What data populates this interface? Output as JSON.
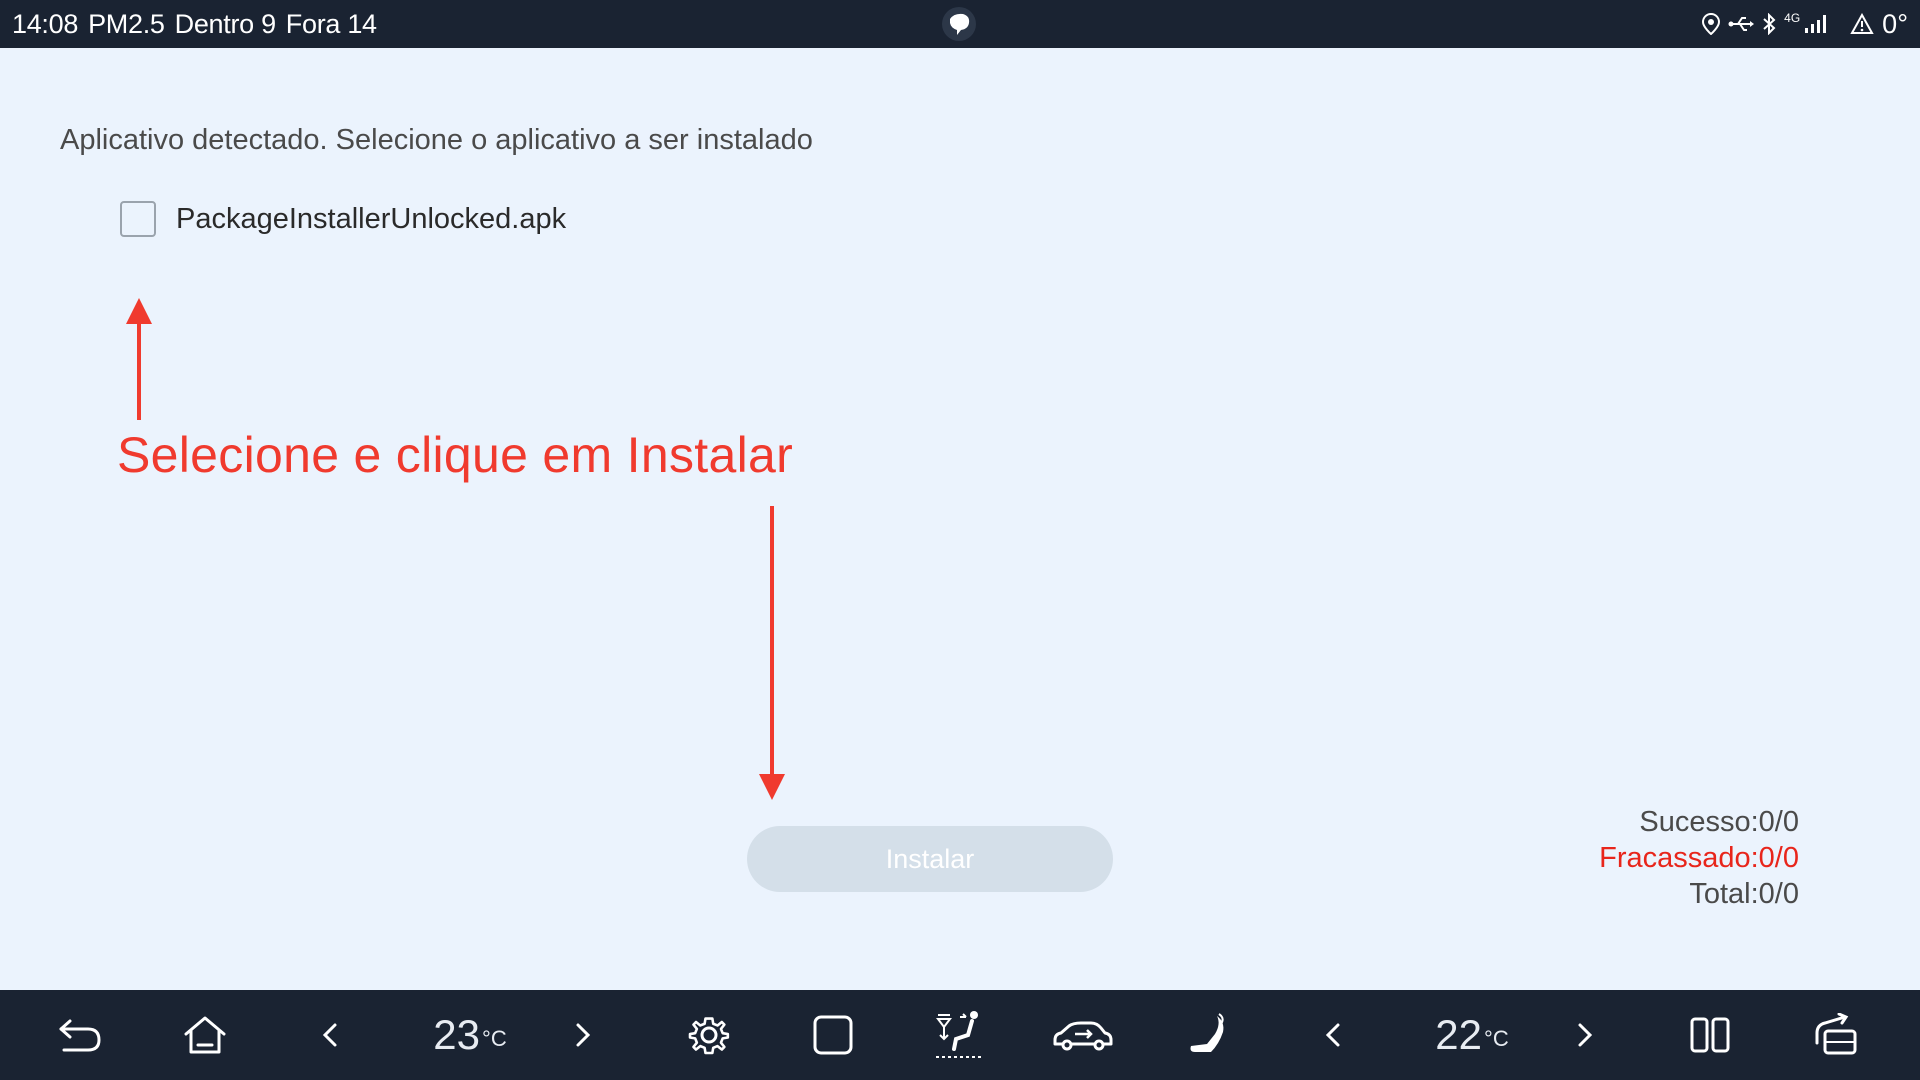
{
  "status_bar": {
    "time": "14:08",
    "air_quality": "PM2.5",
    "inside": "Dentro 9",
    "outside": "Fora 14",
    "network": "4G",
    "temperature": "0°",
    "icons": [
      "location-icon",
      "usb-icon",
      "bluetooth-icon",
      "signal-icon",
      "alert-icon"
    ]
  },
  "main": {
    "prompt": "Aplicativo detectado. Selecione o aplicativo a ser instalado",
    "apk": {
      "name": "PackageInstallerUnlocked.apk",
      "checked": false
    },
    "annotation": "Selecione e clique em Instalar",
    "install_label": "Instalar",
    "stats": {
      "success": "Sucesso:0/0",
      "failed": "Fracassado:0/0",
      "total": "Total:0/0"
    }
  },
  "nav_bar": {
    "left_temp": "23",
    "right_temp": "22",
    "temp_unit": "°C",
    "items": [
      "back-icon",
      "home-icon",
      "chevron-left-icon",
      "chevron-right-icon",
      "gear-icon",
      "square-icon",
      "seat-ventilation-icon",
      "car-icon",
      "seat-heating-icon",
      "split-screen-icon",
      "rear-view-icon"
    ]
  },
  "colors": {
    "bar_background": "#1a2332",
    "page_background": "#ebf3fd",
    "accent_red": "#f03a2e",
    "fail_red": "#e8251b",
    "button_disabled": "#d4dfe9"
  }
}
